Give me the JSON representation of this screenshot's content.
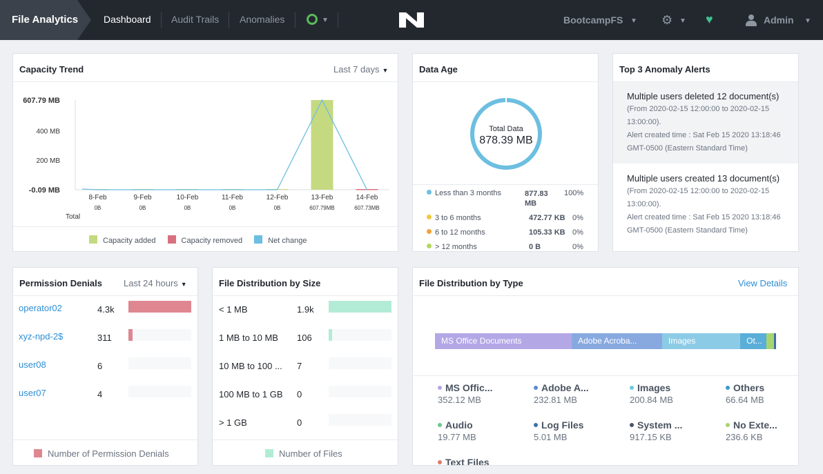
{
  "nav": {
    "brand": "File Analytics",
    "items": [
      "Dashboard",
      "Audit Trails",
      "Anomalies"
    ],
    "cluster": "BootcampFS",
    "user": "Admin"
  },
  "capacity": {
    "title": "Capacity Trend",
    "range": "Last 7 days",
    "total_label": "Total",
    "legend": [
      "Capacity added",
      "Capacity removed",
      "Net change"
    ]
  },
  "chart_data": {
    "type": "bar",
    "title": "Capacity Trend",
    "categories": [
      "8-Feb",
      "9-Feb",
      "10-Feb",
      "11-Feb",
      "12-Feb",
      "13-Feb",
      "14-Feb"
    ],
    "totals": [
      "0B",
      "0B",
      "0B",
      "0B",
      "0B",
      "607.79MB",
      "607.73MB"
    ],
    "series": [
      {
        "name": "Capacity added",
        "color": "#c5d980",
        "values": [
          0,
          0,
          0,
          0,
          0,
          607.79,
          0
        ]
      },
      {
        "name": "Capacity removed",
        "color": "#d9707e",
        "values": [
          0,
          0,
          0,
          0,
          0,
          0,
          0.09
        ]
      },
      {
        "name": "Net change",
        "color": "#6cbfe0",
        "values": [
          0,
          0,
          0,
          0,
          0,
          607.79,
          -0.09
        ]
      }
    ],
    "ylim": [
      -0.09,
      607.79
    ],
    "yticks": [
      {
        "value": 607.79,
        "label": "607.79 MB"
      },
      {
        "value": 400,
        "label": "400 MB"
      },
      {
        "value": 200,
        "label": "200 MB"
      },
      {
        "value": -0.09,
        "label": "-0.09 MB"
      }
    ],
    "legend_position": "bottom"
  },
  "dataage": {
    "title": "Data Age",
    "total_label": "Total Data",
    "total_value": "878.39 MB",
    "rows": [
      {
        "label": "Less than 3 months",
        "size": "877.83 MB",
        "pct": "100%",
        "color": "#6cbfe0"
      },
      {
        "label": "3 to 6 months",
        "size": "472.77 KB",
        "pct": "0%",
        "color": "#f0c93a"
      },
      {
        "label": "6 to 12 months",
        "size": "105.33 KB",
        "pct": "0%",
        "color": "#f0a23a"
      },
      {
        "label": "> 12 months",
        "size": "0 B",
        "pct": "0%",
        "color": "#b4d65e"
      }
    ]
  },
  "anomaly": {
    "title": "Top 3 Anomaly Alerts",
    "alerts": [
      {
        "main": "Multiple users deleted 12 document(s)",
        "range": "(From 2020-02-15 12:00:00 to 2020-02-15 13:00:00).",
        "created": "Alert created time : Sat Feb 15 2020 13:18:46 GMT-0500 (Eastern Standard Time)"
      },
      {
        "main": "Multiple users created 13 document(s)",
        "range": "(From 2020-02-15 12:00:00 to 2020-02-15 13:00:00).",
        "created": "Alert created time : Sat Feb 15 2020 13:18:46 GMT-0500 (Eastern Standard Time)"
      }
    ]
  },
  "permission": {
    "title": "Permission Denials",
    "range": "Last 24 hours",
    "legend": "Number of Permission Denials",
    "color": "#de8791",
    "rows": [
      {
        "user": "operator02",
        "count": "4.3k",
        "frac": 1.0
      },
      {
        "user": "xyz-npd-2$",
        "count": "311",
        "frac": 0.07
      },
      {
        "user": "user08",
        "count": "6",
        "frac": 0
      },
      {
        "user": "user07",
        "count": "4",
        "frac": 0
      }
    ]
  },
  "sizedist": {
    "title": "File Distribution by Size",
    "legend": "Number of Files",
    "color": "#b3ecd6",
    "rows": [
      {
        "label": "< 1 MB",
        "count": "1.9k",
        "frac": 1.0
      },
      {
        "label": "1 MB to 10 MB",
        "count": "106",
        "frac": 0.06
      },
      {
        "label": "10 MB to 100 ...",
        "count": "7",
        "frac": 0
      },
      {
        "label": "100 MB to 1 GB",
        "count": "0",
        "frac": 0
      },
      {
        "label": "> 1 GB",
        "count": "0",
        "frac": 0
      }
    ]
  },
  "typedist": {
    "title": "File Distribution by Type",
    "link": "View Details",
    "segments": [
      {
        "label": "MS Office Documents",
        "frac": 0.401,
        "color": "#b4a7e6"
      },
      {
        "label": "Adobe Acroba...",
        "frac": 0.265,
        "color": "#88a9e0"
      },
      {
        "label": "Images",
        "frac": 0.229,
        "color": "#8ccbe6"
      },
      {
        "label": "Ot...",
        "frac": 0.076,
        "color": "#5aaed8"
      },
      {
        "label": "",
        "frac": 0.023,
        "color": "#a8d46f"
      },
      {
        "label": "",
        "frac": 0.006,
        "color": "#3d6fa8"
      }
    ],
    "items": [
      {
        "label": "MS Offic...",
        "value": "352.12 MB",
        "color": "#b4a7e6"
      },
      {
        "label": "Adobe A...",
        "value": "232.81 MB",
        "color": "#5b8ad6"
      },
      {
        "label": "Images",
        "value": "200.84 MB",
        "color": "#6ccbe0"
      },
      {
        "label": "Others",
        "value": "66.64 MB",
        "color": "#3b9ad2"
      },
      {
        "label": "Audio",
        "value": "19.77 MB",
        "color": "#66c98a"
      },
      {
        "label": "Log Files",
        "value": "5.01 MB",
        "color": "#3d6fa8"
      },
      {
        "label": "System ...",
        "value": "917.15 KB",
        "color": "#4a5468"
      },
      {
        "label": "No Exte...",
        "value": "236.6 KB",
        "color": "#a8d46f"
      },
      {
        "label": "Text Files",
        "value": "",
        "color": "#e07a6a"
      }
    ]
  }
}
